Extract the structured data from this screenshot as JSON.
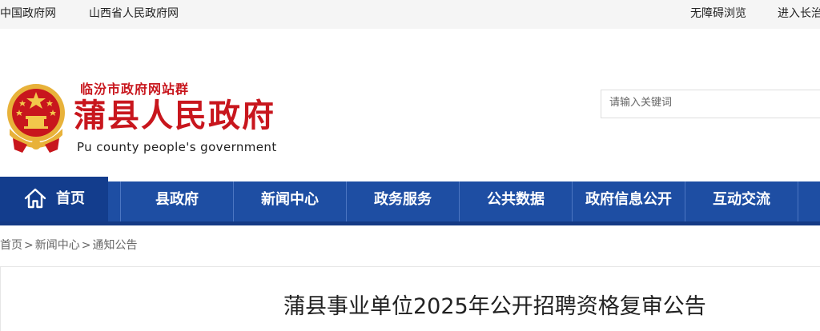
{
  "topbar": {
    "links_left": [
      "中国政府网",
      "山西省人民政府网"
    ],
    "links_right": [
      "无障碍浏览",
      "进入长治"
    ]
  },
  "header": {
    "site_group": "临汾市政府网站群",
    "title": "蒲县人民政府",
    "title_en": "Pu county people's government",
    "search_placeholder": "请输入关键词"
  },
  "nav": {
    "home_label": "首页",
    "items": [
      "县政府",
      "新闻中心",
      "政务服务",
      "公共数据",
      "政府信息公开",
      "互动交流"
    ]
  },
  "breadcrumb": [
    "首页",
    "新闻中心",
    "通知公告"
  ],
  "article": {
    "title": "蒲县事业单位2025年公开招聘资格复审公告"
  },
  "colors": {
    "brand_red": "#c8161d",
    "nav_blue": "#1e4ea3",
    "nav_home_blue": "#133d8d"
  }
}
